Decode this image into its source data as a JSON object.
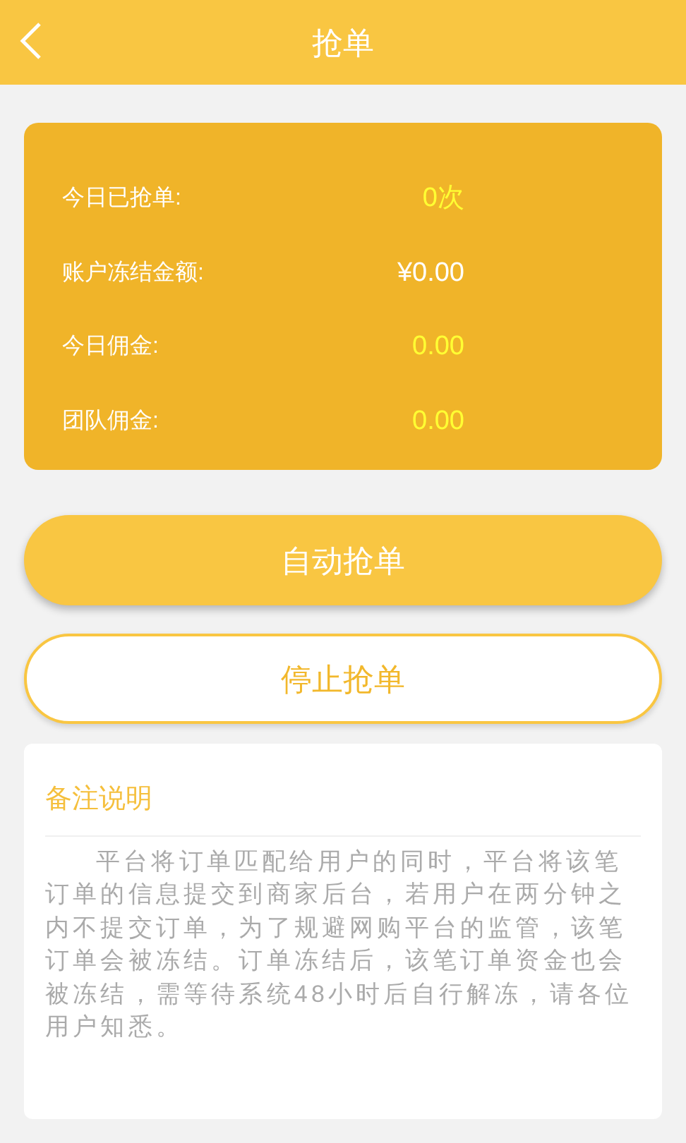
{
  "header": {
    "title": "抢单"
  },
  "stats": [
    {
      "label": "今日已抢单:",
      "value": "0次",
      "color": "#ffff33"
    },
    {
      "label": "账户冻结金额:",
      "value": "¥0.00",
      "color": "#ffffff"
    },
    {
      "label": "今日佣金:",
      "value": "0.00",
      "color": "#ffff33"
    },
    {
      "label": "团队佣金:",
      "value": "0.00",
      "color": "#ffff33"
    }
  ],
  "buttons": [
    {
      "label": "自动抢单",
      "kind": "filled"
    },
    {
      "label": "停止抢单",
      "kind": "outline"
    }
  ],
  "notes": {
    "title": "备注说明",
    "text": "平台将订单匹配给用户的同时，平台将该笔订单的信息提交到商家后台，若用户在两分钟之内不提交订单，为了规避网购平台的监管，该笔订单会被冻结。订单冻结后，该笔订单资金也会被冻结，需等待系统48小时后自行解冻，请各位用户知悉。"
  }
}
